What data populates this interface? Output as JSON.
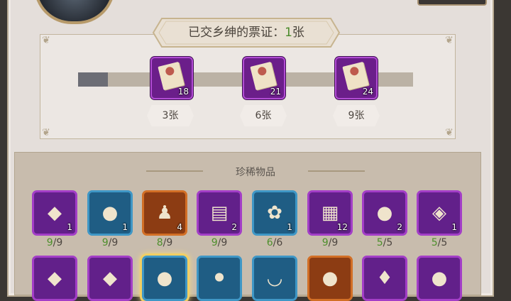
{
  "banner": {
    "label": "已交乡绅的票证：",
    "count": "1",
    "unit": "张"
  },
  "milestones": [
    {
      "reward_count": "18",
      "threshold": "3张",
      "icon": "scroll-ticket-icon"
    },
    {
      "reward_count": "21",
      "threshold": "6张",
      "icon": "scroll-ticket-icon"
    },
    {
      "reward_count": "24",
      "threshold": "9张",
      "icon": "scroll-ticket-icon"
    }
  ],
  "progress_fraction": 0.09,
  "rare_section": {
    "title": "珍稀物品"
  },
  "items_row1": [
    {
      "icon": "gold-ingot-icon",
      "glyph": "◆",
      "rarity": "purple",
      "count": "1",
      "have": "9",
      "max": "9"
    },
    {
      "icon": "crystal-ball-icon",
      "glyph": "●",
      "rarity": "blue",
      "count": "1",
      "have": "9",
      "max": "9"
    },
    {
      "icon": "figurine-icon",
      "glyph": "♟",
      "rarity": "orange",
      "count": "4",
      "have": "8",
      "max": "9"
    },
    {
      "icon": "letter-scroll-icon",
      "glyph": "▤",
      "rarity": "purple",
      "count": "2",
      "have": "9",
      "max": "9"
    },
    {
      "icon": "lotus-icon",
      "glyph": "✿",
      "rarity": "blue",
      "count": "1",
      "have": "6",
      "max": "6"
    },
    {
      "icon": "ancient-tablet-icon",
      "glyph": "▦",
      "rarity": "purple",
      "count": "12",
      "have": "9",
      "max": "9"
    },
    {
      "icon": "iron-ball-icon",
      "glyph": "●",
      "rarity": "purple",
      "count": "2",
      "have": "5",
      "max": "5"
    },
    {
      "icon": "gemstone-icon",
      "glyph": "◈",
      "rarity": "purple",
      "count": "1",
      "have": "5",
      "max": "5"
    }
  ],
  "items_row2": [
    {
      "icon": "red-ore-icon",
      "glyph": "◆",
      "rarity": "purple"
    },
    {
      "icon": "dark-ore-icon",
      "glyph": "◆",
      "rarity": "purple"
    },
    {
      "icon": "red-pearl-icon",
      "glyph": "●",
      "rarity": "blue",
      "selected": true
    },
    {
      "icon": "go-stones-icon",
      "glyph": "⚫",
      "rarity": "blue"
    },
    {
      "icon": "jade-bowl-icon",
      "glyph": "◡",
      "rarity": "blue"
    },
    {
      "icon": "amber-orb-icon",
      "glyph": "●",
      "rarity": "orange"
    },
    {
      "icon": "pouch-icon",
      "glyph": "♦",
      "rarity": "purple"
    },
    {
      "icon": "ruby-orb-icon",
      "glyph": "●",
      "rarity": "purple"
    }
  ]
}
